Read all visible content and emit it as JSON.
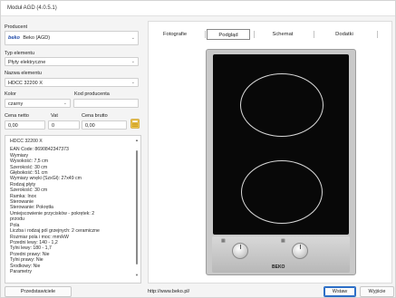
{
  "window": {
    "title": "Moduł AGD  (4.0.5.1)"
  },
  "form": {
    "manufacturer": {
      "label": "Producent",
      "logo_text": "beko",
      "value": "Beko (AGD)"
    },
    "element_type": {
      "label": "Typ elementu",
      "value": "Płyty elektryczne"
    },
    "element_name": {
      "label": "Nazwa elementu",
      "value": "HDCC 32200 X"
    },
    "color": {
      "label": "Kolor",
      "value": "czarny"
    },
    "producer_code": {
      "label": "Kod producenta",
      "value": ""
    },
    "net_price": {
      "label": "Cena netto",
      "value": "0,00"
    },
    "vat": {
      "label": "Vat",
      "value": "0"
    },
    "gross_price": {
      "label": "Cena brutto",
      "value": "0,00"
    }
  },
  "description": {
    "lines": [
      "HDCC 32200 X",
      "",
      "EAN Code: 8690842347373",
      "Wymiary",
      "Wysokość: 7,5 cm",
      "Szerokość: 30 cm",
      "Głębokość: 51 cm",
      "Wymiary wnęki (SzxGł): 27x49 cm",
      "Rodzaj płyty",
      "Szerokość: 30 cm",
      "Ramka: Inox",
      "Sterowanie",
      "Sterowanie: Pokrętła",
      "Umiejscowienie przycisków - pokrętek: 2",
      "przodu",
      "Pola",
      "Liczba i rodzaj pól grzejnych: 2 ceramiczne",
      "Rozmiar pola i moc: mm/kW",
      "Przedni lewy: 140 - 1,2",
      "Tylni lewy: 180 - 1,7",
      "Przedni prawy: Nie",
      "Tylni prawy: Nie",
      "Środkowy: Nie",
      "Parametry"
    ]
  },
  "buttons": {
    "favorites": "Przedstawiciele",
    "insert": "Wstaw",
    "exit": "Wyjście"
  },
  "tabs": [
    "Fotografie",
    "Podgląd",
    "Schemat",
    "Dodatki"
  ],
  "active_tab": "Podgląd",
  "preview": {
    "brand": "BEKO",
    "url": "http://www.beko.pl/"
  },
  "colors": {
    "accent": "#2d6fc7",
    "brand": "#1f4aa8",
    "glass": "#080808"
  },
  "icons": {
    "calculator": "calculator-icon",
    "chevron": "chevron-down-icon"
  }
}
